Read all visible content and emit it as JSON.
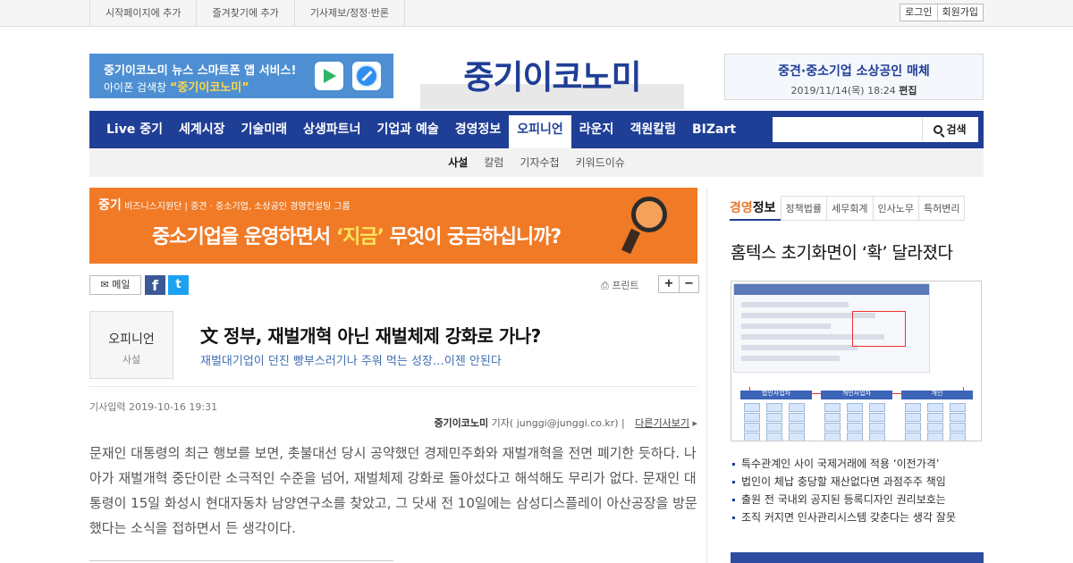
{
  "topbar": {
    "links": [
      "시작페이지에 추가",
      "즐겨찾기에 추가",
      "기사제보/정정·반론"
    ],
    "login": "로그인",
    "signup": "회원가입"
  },
  "promo_left": {
    "line1": "중기이코노미 뉴스 스마트폰 앱 서비스!",
    "line2_prefix": "아이폰 검색창",
    "line2_highlight": "“중기이코노미”"
  },
  "logo": "중기이코노미",
  "promo_right": {
    "title": "중견·중소기업 소상공인 매체",
    "date": "2019/11/14(목) 18:24",
    "edit": "편집"
  },
  "nav": {
    "items": [
      "Live 중기",
      "세계시장",
      "기술미래",
      "상생파트너",
      "기업과 예술",
      "경영정보",
      "오피니언",
      "라운지",
      "객원칼럼",
      "BIZart"
    ],
    "active_index": 6,
    "search_button": "검색"
  },
  "subnav": {
    "items": [
      "사설",
      "칼럼",
      "기자수첩",
      "키워드이슈"
    ],
    "active_index": 0
  },
  "banner": {
    "brand": "중기",
    "brand_suffix": "비즈니스지원단",
    "head_text": "중견 · 중소기업, 소상공인 경영컨설팅 그룹",
    "main_prefix": "중소기업을 운영하면서",
    "main_highlight": "‘지금’",
    "main_suffix": "무엇이 궁금하십니까?"
  },
  "tools": {
    "mail": "메일",
    "facebook": "f",
    "twitter": "t",
    "print": "프린트",
    "zoom_in": "+",
    "zoom_out": "−"
  },
  "article": {
    "category": "오피니언",
    "subcategory": "사설",
    "title": "文 정부, 재벌개혁 아닌 재벌체제 강화로 가나?",
    "subtitle": "재벌대기업이 던진 빵부스러기나 주워 먹는 성장…이젠 안된다",
    "date_label": "기사입력",
    "date": "2019-10-16 19:31",
    "author": "중기이코노미",
    "author_role": "기자",
    "email": "junggi@junggi.co.kr",
    "more_link": "다른기사보기",
    "body": "문재인 대통령의 최근 행보를 보면, 촛불대선 당시 공약했던 경제민주화와 재벌개혁을 전면 폐기한 듯하다. 나아가 재벌개혁 중단이란 소극적인 수준을 넘어, 재벌체제 강화로 돌아섰다고 해석해도 무리가 없다. 문재인 대통령이 15일 화성시 현대자동차 남양연구소를 찾았고, 그 닷새 전 10일에는 삼성디스플레이 아산공장을 방문했다는 소식을 접하면서 든 생각이다."
  },
  "sidebar": {
    "tab_main_prefix": "경영",
    "tab_main_suffix": "정보",
    "tabs": [
      "정책법률",
      "세무회계",
      "인사노무",
      "특허변리"
    ],
    "headline": "홈텍스 초기화면이 ‘확’ 달라졌다",
    "image_labels": [
      "법인사업자",
      "개인사업자",
      "개인"
    ],
    "list": [
      "특수관계인 사이 국제거래에 적용 ‘이전가격’",
      "법인이 체납 충당할 재산없다면 과점주주 책임",
      "출원 전 국내외 공지된 등록디자인 권리보호는",
      "조직 커지면 인사관리시스템 갖춘다는 생각 잘못"
    ]
  },
  "colors": {
    "brand": "#1f3e96",
    "banner": "#f07a26",
    "highlight": "#ffe45a"
  }
}
